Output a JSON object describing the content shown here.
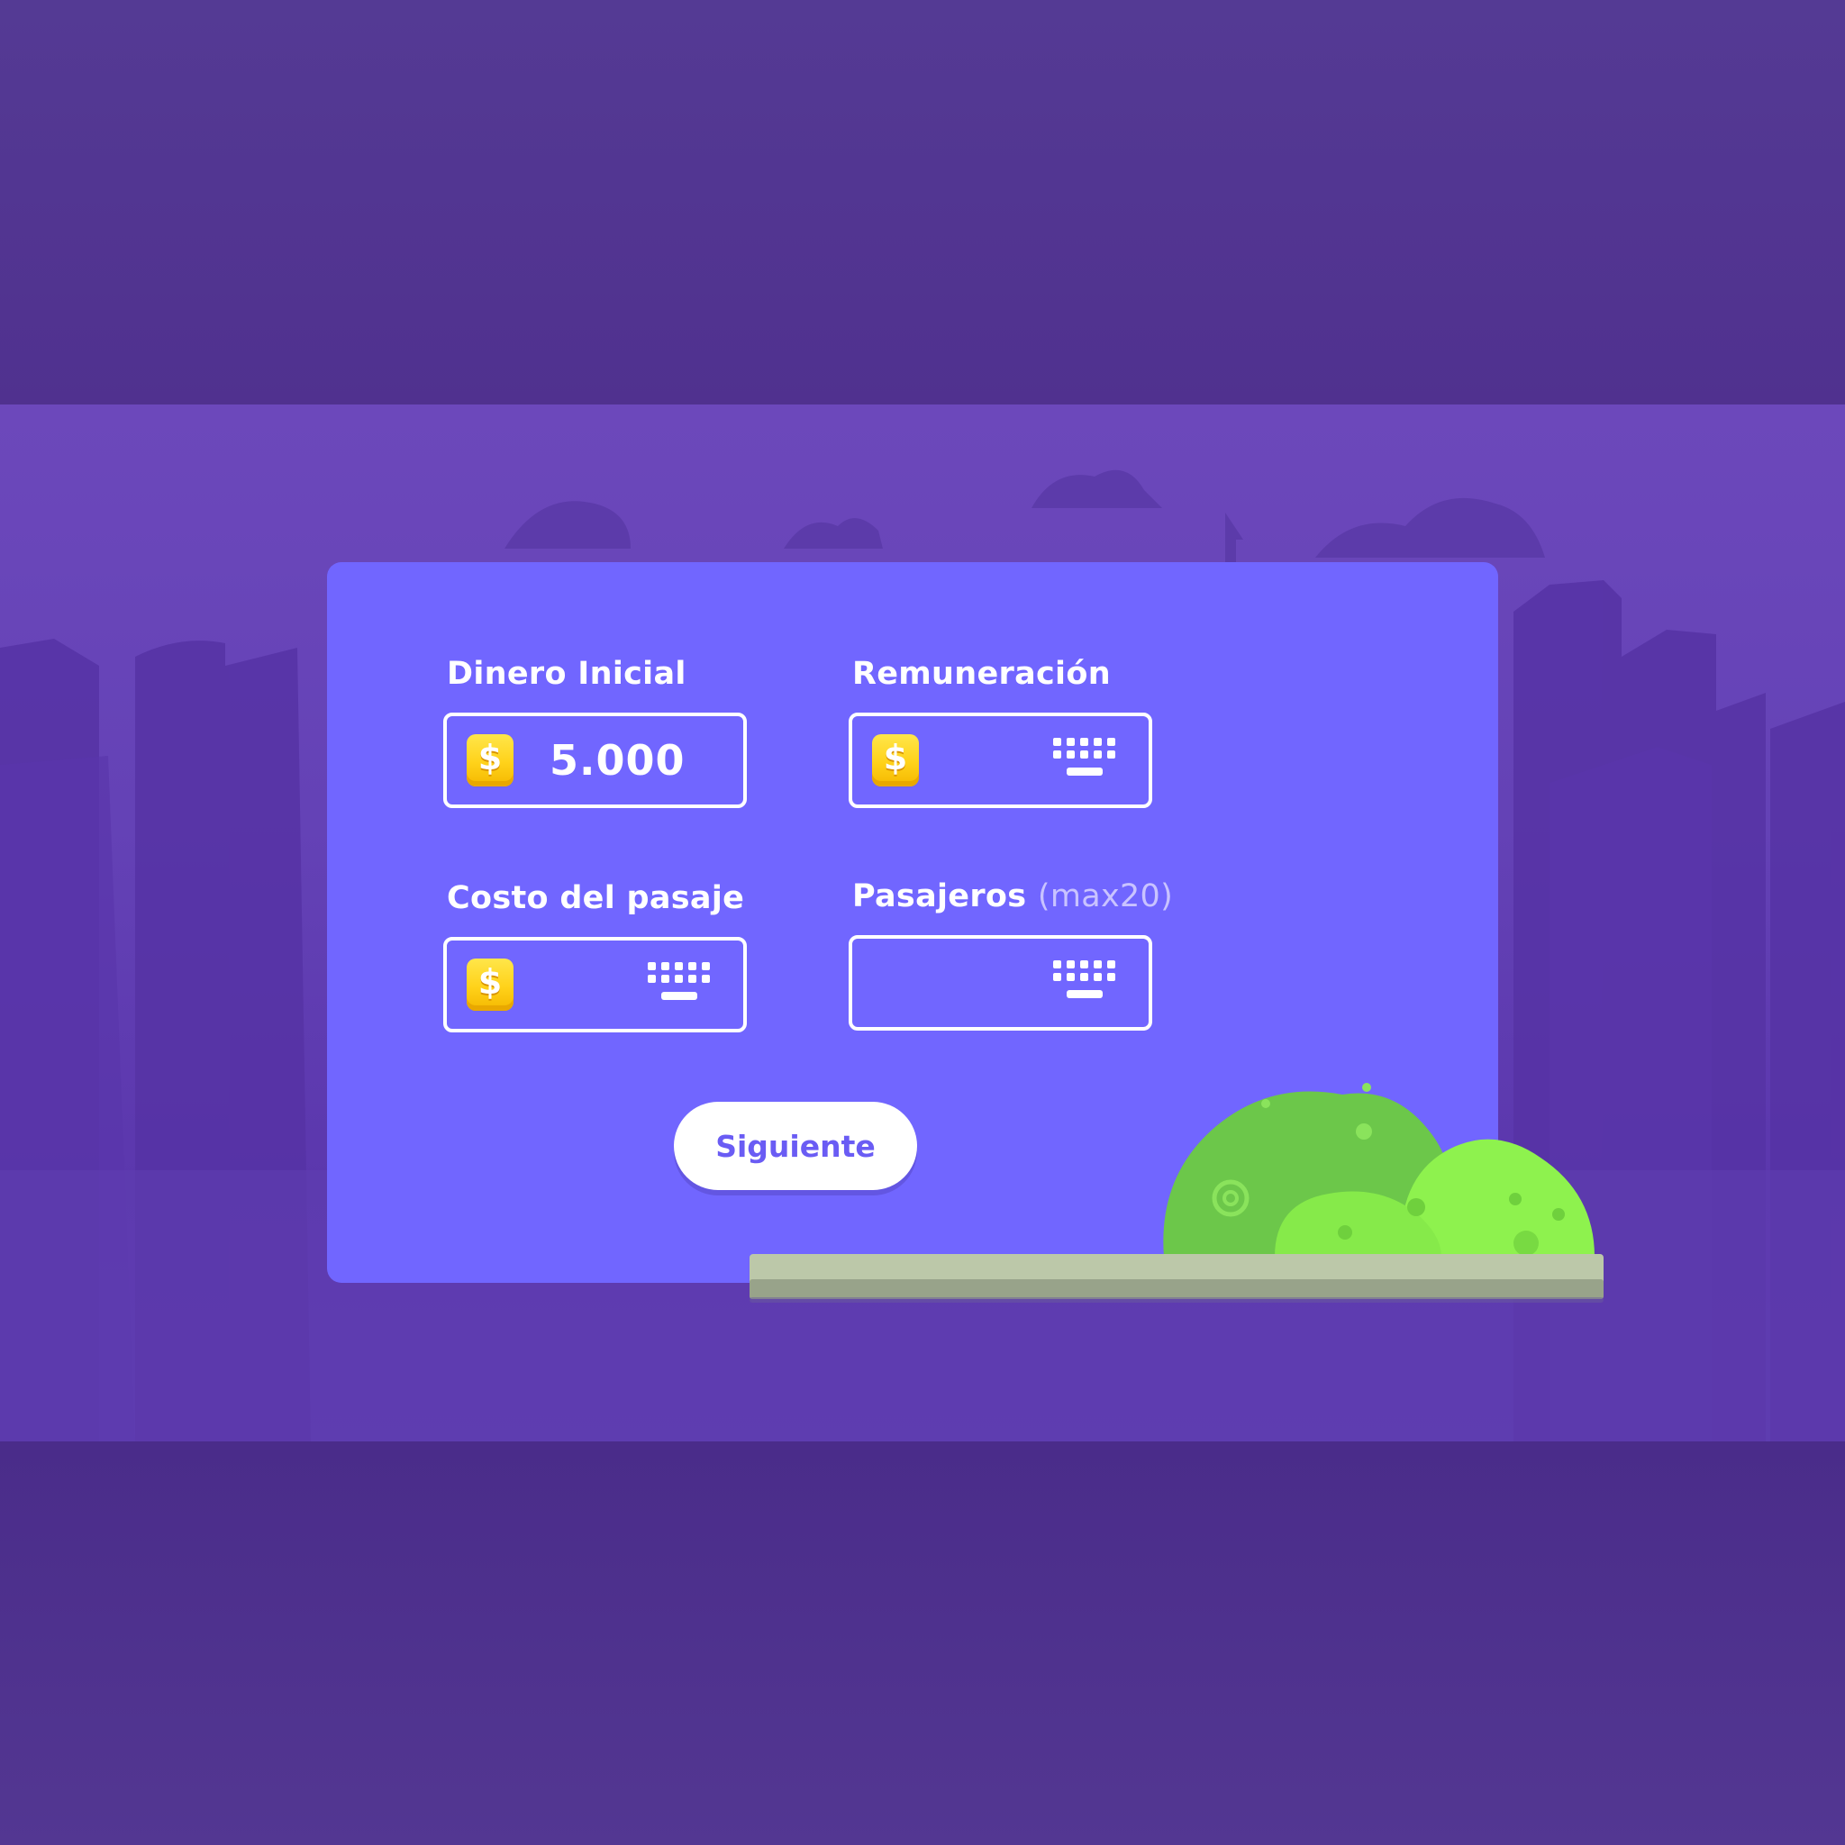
{
  "form": {
    "initial_money": {
      "label": "Dinero Inicial",
      "currency_icon": "$",
      "value": "5.000"
    },
    "remuneration": {
      "label": "Remuneración",
      "currency_icon": "$",
      "value": ""
    },
    "fare_cost": {
      "label": "Costo del pasaje",
      "currency_icon": "$",
      "value": ""
    },
    "passengers": {
      "label": "Pasajeros",
      "hint": "(max20)",
      "value": ""
    },
    "next_button_label": "Siguiente"
  },
  "icons": {
    "coin": "coin-dollar-icon",
    "keyboard": "keyboard-icon"
  },
  "colors": {
    "card": "#7166ff",
    "background": "#533792",
    "scene": "#6442b6",
    "coin": "#ffd21a",
    "button_text": "#6a5cf4",
    "bush": "#7ddb45",
    "ledge": "#b9c4a6"
  }
}
